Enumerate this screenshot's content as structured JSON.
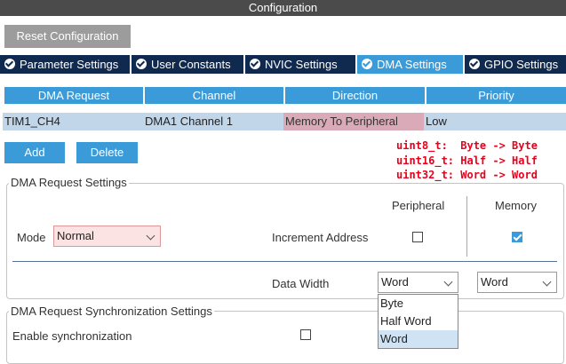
{
  "window": {
    "title": "Configuration"
  },
  "toolbar": {
    "reset_label": "Reset Configuration"
  },
  "tabs": [
    {
      "label": "Parameter Settings",
      "active": false
    },
    {
      "label": "User Constants",
      "active": false
    },
    {
      "label": "NVIC Settings",
      "active": false
    },
    {
      "label": "DMA Settings",
      "active": true
    },
    {
      "label": "GPIO Settings",
      "active": false
    }
  ],
  "table": {
    "headers": [
      "DMA Request",
      "Channel",
      "Direction",
      "Priority"
    ],
    "rows": [
      {
        "request": "TIM1_CH4",
        "channel": "DMA1 Channel 1",
        "direction": "Memory To Peripheral",
        "priority": "Low"
      }
    ]
  },
  "actions": {
    "add_label": "Add",
    "delete_label": "Delete"
  },
  "notes": [
    "uint8_t:  Byte -> Byte",
    "uint16_t: Half -> Half",
    "uint32_t: Word -> Word"
  ],
  "request_settings": {
    "legend": "DMA Request Settings",
    "peripheral_header": "Peripheral",
    "memory_header": "Memory",
    "mode_label": "Mode",
    "mode_value": "Normal",
    "increment_label": "Increment Address",
    "peripheral_increment": false,
    "memory_increment": true,
    "data_width_label": "Data Width",
    "peripheral_width": "Word",
    "memory_width": "Word",
    "width_options": [
      "Byte",
      "Half Word",
      "Word"
    ]
  },
  "sync_settings": {
    "legend": "DMA Request Synchronization Settings",
    "enable_label": "Enable synchronization",
    "enabled": false
  },
  "colors": {
    "accent": "#3a9bd8",
    "tab_dark": "#10294f",
    "note_red": "#e8001c",
    "row_highlight": "#dbaab8",
    "row_bg": "#c2d6ea"
  }
}
